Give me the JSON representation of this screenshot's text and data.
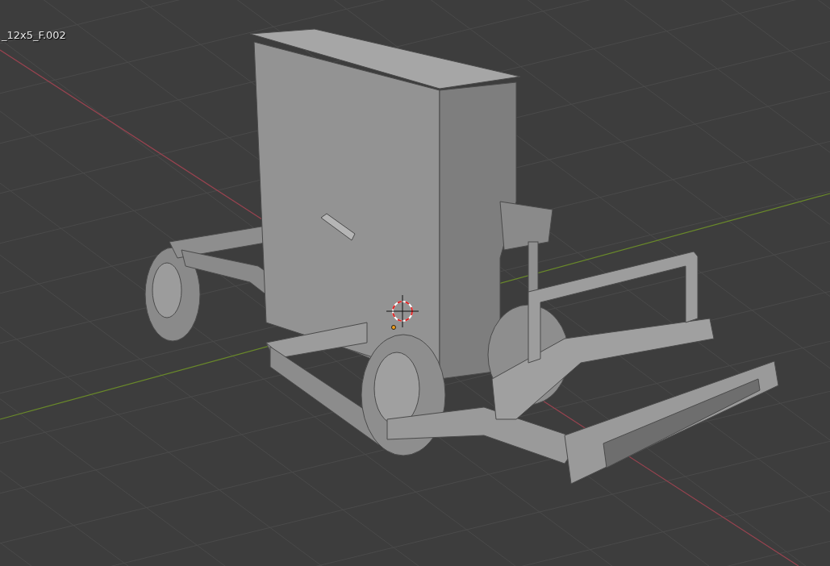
{
  "viewport": {
    "object_label": "_12x5_F.002"
  }
}
